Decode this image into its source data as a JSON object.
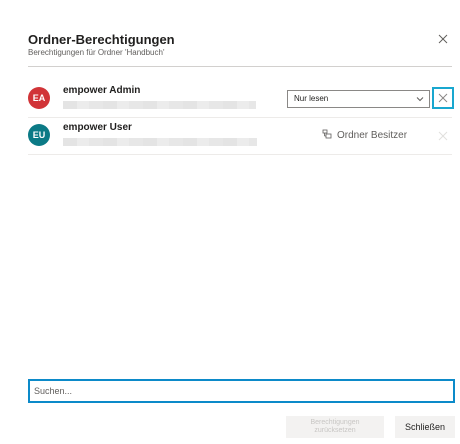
{
  "dialog": {
    "title": "Ordner-Berechtigungen",
    "subtitle": "Berechtigungen für Ordner 'Handbuch'"
  },
  "users": [
    {
      "initials": "EA",
      "name": "empower Admin",
      "avatar_color": "#d13438",
      "permission": "Nur lesen"
    },
    {
      "initials": "EU",
      "name": "empower User",
      "avatar_color": "#0b7a86",
      "role": "Ordner Besitzer"
    }
  ],
  "search": {
    "placeholder": "Suchen..."
  },
  "footer": {
    "reset_label_line1": "Berechtigungen",
    "reset_label_line2": "zurücksetzen",
    "close_label": "Schließen"
  },
  "colors": {
    "accent": "#0c8ac9",
    "focus_border": "#19a7cf"
  },
  "icons": {
    "close": "close-icon",
    "chevron": "chevron-down-icon",
    "owner": "owner-icon",
    "remove": "remove-icon"
  }
}
